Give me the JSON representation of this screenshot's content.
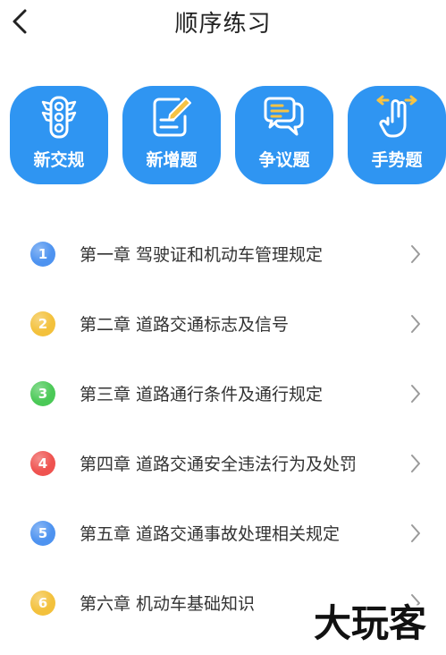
{
  "header": {
    "title": "顺序练习"
  },
  "categories": [
    {
      "label": "新交规",
      "icon": "traffic-light-icon"
    },
    {
      "label": "新增题",
      "icon": "edit-paper-icon"
    },
    {
      "label": "争议题",
      "icon": "chat-bubbles-icon"
    },
    {
      "label": "手势题",
      "icon": "hand-gesture-icon"
    }
  ],
  "chapters": [
    {
      "num": "1",
      "label": "第一章  驾驶证和机动车管理规定",
      "color": "#4e93f0"
    },
    {
      "num": "2",
      "label": "第二章  道路交通标志及信号",
      "color": "#f3c13c"
    },
    {
      "num": "3",
      "label": "第三章  道路通行条件及通行规定",
      "color": "#4bc957"
    },
    {
      "num": "4",
      "label": "第四章  道路交通安全违法行为及处罚",
      "color": "#ef5350"
    },
    {
      "num": "5",
      "label": "第五章  道路交通事故处理相关规定",
      "color": "#4e93f0"
    },
    {
      "num": "6",
      "label": "第六章  机动车基础知识",
      "color": "#f3c13c"
    }
  ],
  "watermark": {
    "text": "大玩客"
  },
  "theme": {
    "accent": "#2f95f2",
    "chevron": "#9a9a9a"
  }
}
